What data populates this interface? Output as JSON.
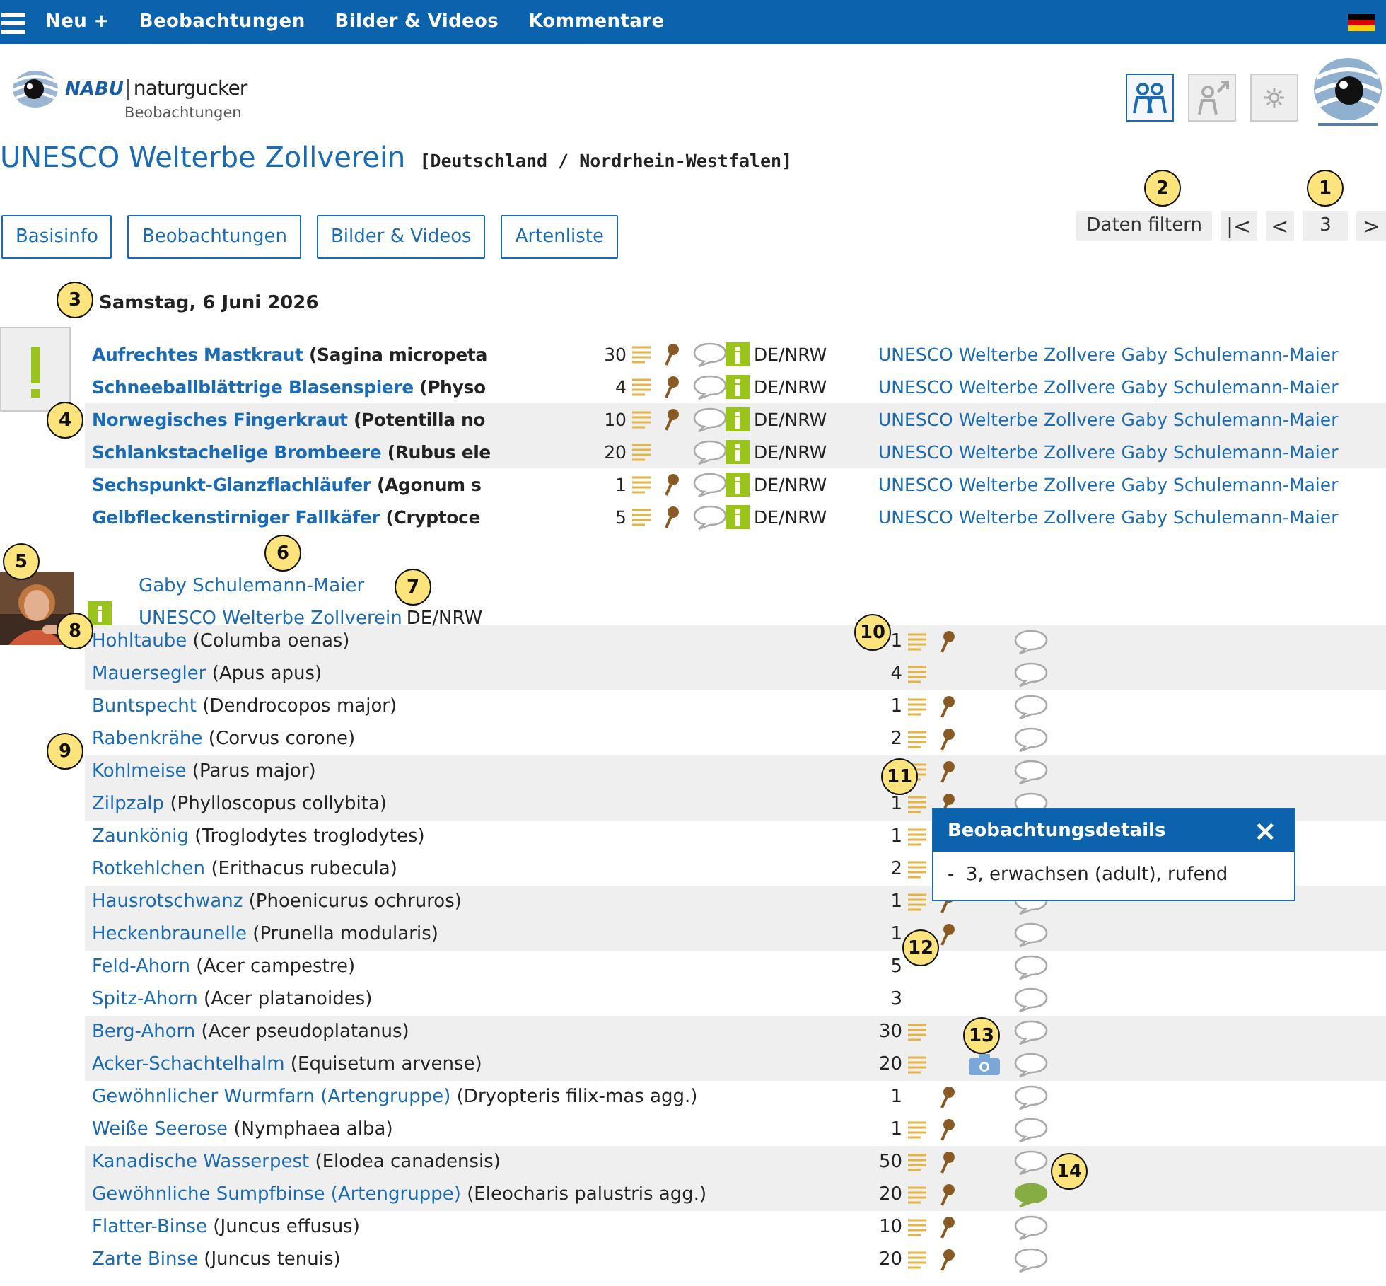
{
  "menu_bar": {
    "items": [
      "Neu +",
      "Beobachtungen",
      "Bilder & Videos",
      "Kommentare"
    ]
  },
  "logo": {
    "brand": "NABU",
    "name": "naturgucker",
    "subtitle": "Beobachtungen"
  },
  "header_buttons": [
    {
      "kind": "people",
      "active": true
    },
    {
      "kind": "share",
      "active": false
    },
    {
      "kind": "settings",
      "active": false
    }
  ],
  "title": "UNESCO Welterbe Zollverein",
  "region": "[Deutschland / Nordrhein-Westfalen]",
  "tabs": [
    "Basisinfo",
    "Beobachtungen",
    "Bilder & Videos",
    "Artenliste"
  ],
  "filter_button": "Daten filtern",
  "pager": [
    "|<",
    "<",
    "3",
    ">"
  ],
  "date": "Samstag, 6 Juni 2026",
  "summary_rows": [
    {
      "name": "Aufrechtes Mastkraut",
      "scientific": "(Sagina micropeta",
      "count": "30",
      "details": true,
      "pin": true,
      "region": "DE/NRW",
      "location": "UNESCO Welterbe Zollvere",
      "observer": "Gaby Schulemann-Maier"
    },
    {
      "name": "Schneeballblättrige Blasenspiere",
      "scientific": "(Physo",
      "count": "4",
      "details": true,
      "pin": true,
      "region": "DE/NRW",
      "location": "UNESCO Welterbe Zollvere",
      "observer": "Gaby Schulemann-Maier"
    },
    {
      "name": "Norwegisches Fingerkraut",
      "scientific": "(Potentilla no",
      "count": "10",
      "details": true,
      "pin": true,
      "region": "DE/NRW",
      "location": "UNESCO Welterbe Zollvere",
      "observer": "Gaby Schulemann-Maier"
    },
    {
      "name": "Schlankstachelige Brombeere",
      "scientific": "(Rubus ele",
      "count": "20",
      "details": true,
      "pin": false,
      "region": "DE/NRW",
      "location": "UNESCO Welterbe Zollvere",
      "observer": "Gaby Schulemann-Maier"
    },
    {
      "name": "Sechspunkt-Glanzflachläufer",
      "scientific": "(Agonum s",
      "count": "1",
      "details": true,
      "pin": true,
      "region": "DE/NRW",
      "location": "UNESCO Welterbe Zollvere",
      "observer": "Gaby Schulemann-Maier"
    },
    {
      "name": "Gelbfleckenstirniger Fallkäfer",
      "scientific": "(Cryptoce",
      "count": "5",
      "details": true,
      "pin": true,
      "region": "DE/NRW",
      "location": "UNESCO Welterbe Zollvere",
      "observer": "Gaby Schulemann-Maier"
    }
  ],
  "observer": {
    "name": "Gaby Schulemann-Maier",
    "location": "UNESCO Welterbe Zollverein",
    "region": "DE/NRW"
  },
  "species_rows": [
    {
      "name": "Hohltaube",
      "scientific": "(Columba oenas)",
      "count": "1",
      "details": true,
      "pin": true,
      "photo": false,
      "commented": false
    },
    {
      "name": "Mauersegler",
      "scientific": "(Apus apus)",
      "count": "4",
      "details": true,
      "pin": false,
      "photo": false,
      "commented": false
    },
    {
      "name": "Buntspecht",
      "scientific": "(Dendrocopos major)",
      "count": "1",
      "details": true,
      "pin": true,
      "photo": false,
      "commented": false
    },
    {
      "name": "Rabenkrähe",
      "scientific": "(Corvus corone)",
      "count": "2",
      "details": true,
      "pin": true,
      "photo": false,
      "commented": false
    },
    {
      "name": "Kohlmeise",
      "scientific": "(Parus major)",
      "details": true,
      "pin": true,
      "photo": false,
      "commented": false
    },
    {
      "name": "Zilpzalp",
      "scientific": "(Phylloscopus collybita)",
      "count": "1",
      "details": true,
      "pin": true,
      "photo": false,
      "commented": false
    },
    {
      "name": "Zaunkönig",
      "scientific": "(Troglodytes troglodytes)",
      "count": "1",
      "details": true,
      "pin": false,
      "photo": false
    },
    {
      "name": "Rotkehlchen",
      "scientific": "(Erithacus rubecula)",
      "count": "2",
      "details": true,
      "pin": false,
      "photo": false
    },
    {
      "name": "Hausrotschwanz",
      "scientific": "(Phoenicurus ochruros)",
      "count": "1",
      "details": true,
      "pin": true,
      "photo": false,
      "commented": false
    },
    {
      "name": "Heckenbraunelle",
      "scientific": "(Prunella modularis)",
      "count": "1",
      "details": false,
      "pin": true,
      "photo": false,
      "commented": false
    },
    {
      "name": "Feld-Ahorn",
      "scientific": "(Acer campestre)",
      "count": "5",
      "details": false,
      "pin": false,
      "photo": false,
      "commented": false
    },
    {
      "name": "Spitz-Ahorn",
      "scientific": "(Acer platanoides)",
      "count": "3",
      "details": false,
      "pin": false,
      "photo": false,
      "commented": false
    },
    {
      "name": "Berg-Ahorn",
      "scientific": "(Acer pseudoplatanus)",
      "count": "30",
      "details": true,
      "pin": false,
      "photo": false,
      "commented": false
    },
    {
      "name": "Acker-Schachtelhalm",
      "scientific": "(Equisetum arvense)",
      "count": "20",
      "details": true,
      "pin": false,
      "photo": true,
      "commented": false
    },
    {
      "name": "Gewöhnlicher Wurmfarn (Artengruppe)",
      "scientific": "(Dryopteris filix-mas agg.)",
      "count": "1",
      "details": false,
      "pin": true,
      "photo": false,
      "commented": false
    },
    {
      "name": "Weiße Seerose",
      "scientific": "(Nymphaea alba)",
      "count": "1",
      "details": true,
      "pin": true,
      "photo": false,
      "commented": false
    },
    {
      "name": "Kanadische Wasserpest",
      "scientific": "(Elodea canadensis)",
      "count": "50",
      "details": true,
      "pin": true,
      "photo": false,
      "commented": false
    },
    {
      "name": "Gewöhnliche Sumpfbinse (Artengruppe)",
      "scientific": "(Eleocharis palustris agg.)",
      "count": "20",
      "details": true,
      "pin": true,
      "photo": false,
      "commented": true
    },
    {
      "name": "Flatter-Binse",
      "scientific": "(Juncus effusus)",
      "count": "10",
      "details": true,
      "pin": true,
      "photo": false,
      "commented": false
    },
    {
      "name": "Zarte Binse",
      "scientific": "(Juncus tenuis)",
      "count": "20",
      "details": true,
      "pin": true,
      "photo": false,
      "commented": false
    }
  ],
  "popup": {
    "title": "Beobachtungsdetails",
    "close": "×",
    "text": "-  3, erwachsen (adult), rufend"
  },
  "callouts": [
    "1",
    "2",
    "3",
    "4",
    "5",
    "6",
    "7",
    "8",
    "9",
    "10",
    "11",
    "12",
    "13",
    "14"
  ]
}
